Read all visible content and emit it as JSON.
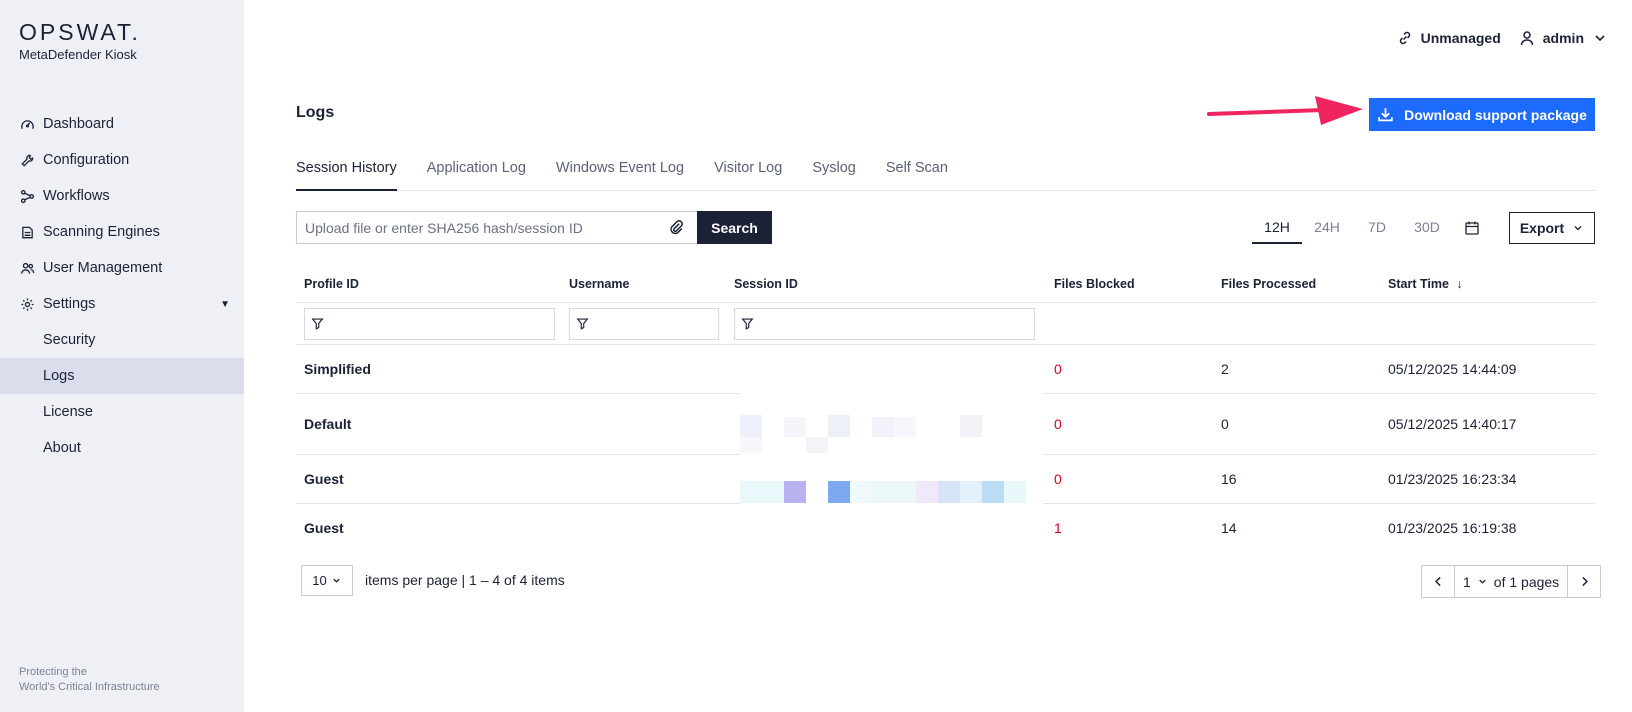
{
  "brand": {
    "logo": "OPSWAT.",
    "product": "MetaDefender Kiosk"
  },
  "sidebar": {
    "items": [
      {
        "label": "Dashboard",
        "icon": "dashboard-icon"
      },
      {
        "label": "Configuration",
        "icon": "wrench-icon"
      },
      {
        "label": "Workflows",
        "icon": "workflow-icon"
      },
      {
        "label": "Scanning Engines",
        "icon": "engine-icon"
      },
      {
        "label": "User Management",
        "icon": "users-icon"
      },
      {
        "label": "Settings",
        "icon": "gear-icon"
      }
    ],
    "sub_items": [
      {
        "label": "Security"
      },
      {
        "label": "Logs"
      },
      {
        "label": "License"
      },
      {
        "label": "About"
      }
    ],
    "footer": [
      "Protecting the",
      "World's Critical Infrastructure"
    ]
  },
  "topbar": {
    "unmanaged": "Unmanaged",
    "user": "admin"
  },
  "page": {
    "title": "Logs",
    "download_label": "Download support package"
  },
  "tabs": [
    {
      "label": "Session History"
    },
    {
      "label": "Application Log"
    },
    {
      "label": "Windows Event Log"
    },
    {
      "label": "Visitor Log"
    },
    {
      "label": "Syslog"
    },
    {
      "label": "Self Scan"
    }
  ],
  "search": {
    "placeholder": "Upload file or enter SHA256 hash/session ID",
    "button": "Search"
  },
  "range": {
    "options": [
      "12H",
      "24H",
      "7D",
      "30D"
    ],
    "selected": "12H"
  },
  "export_label": "Export",
  "table": {
    "headers": {
      "profile": "Profile ID",
      "username": "Username",
      "session": "Session ID",
      "blocked": "Files Blocked",
      "processed": "Files Processed",
      "start": "Start Time"
    },
    "rows": [
      {
        "profile": "Simplified",
        "blocked": "0",
        "processed": "2",
        "start": "05/12/2025 14:44:09"
      },
      {
        "profile": "Default",
        "blocked": "0",
        "processed": "0",
        "start": "05/12/2025 14:40:17"
      },
      {
        "profile": "Guest",
        "blocked": "0",
        "processed": "16",
        "start": "01/23/2025 16:23:34"
      },
      {
        "profile": "Guest",
        "blocked": "1",
        "processed": "14",
        "start": "01/23/2025 16:19:38"
      }
    ]
  },
  "pagination": {
    "per_page": "10",
    "summary": "items per page | 1 – 4 of 4 items",
    "page": "1",
    "of_pages": "of 1 pages"
  }
}
